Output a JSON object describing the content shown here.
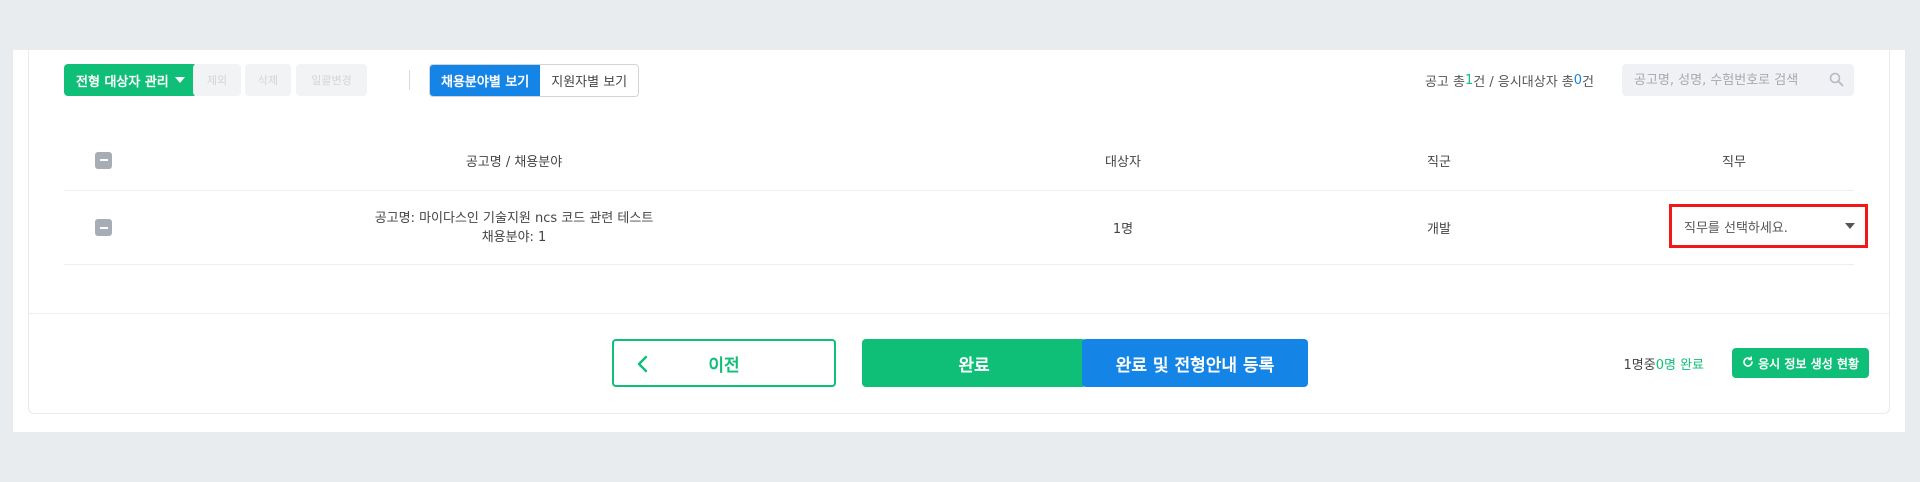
{
  "toolbar": {
    "manage_label": "전형 대상자 관리",
    "ghost_buttons": [
      "제외",
      "삭제",
      "일괄변경"
    ],
    "view_by_field": "채용분야별 보기",
    "view_by_applicant": "지원자별 보기"
  },
  "summary": {
    "prefix": "공고 총 ",
    "posting_count": "1",
    "mid": "건 / 응시대상자 총 ",
    "applicant_count": "0",
    "suffix": "건"
  },
  "search": {
    "placeholder": "공고명, 성명, 수험번호로 검색"
  },
  "table": {
    "headers": {
      "title": "공고명 / 채용분야",
      "target": "대상자",
      "group": "직군",
      "duty": "직무"
    },
    "rows": [
      {
        "title_line1": "공고명: 마이다스인 기술지원 ncs 코드 관련 테스트",
        "title_line2": "채용분야: 1",
        "target": "1명",
        "group": "개발",
        "duty_placeholder": "직무를 선택하세요."
      }
    ]
  },
  "footer": {
    "prev_label": "이전",
    "done_label": "완료",
    "done_register_label": "완료 및 전형안내 등록",
    "progress_total": "1명",
    "progress_mid": " 중 ",
    "progress_done": "0명 완료",
    "status_label": "응시 정보 생성 현황"
  },
  "colors": {
    "green": "#0fbf78",
    "blue": "#1484e6",
    "highlight": "#f01818"
  }
}
